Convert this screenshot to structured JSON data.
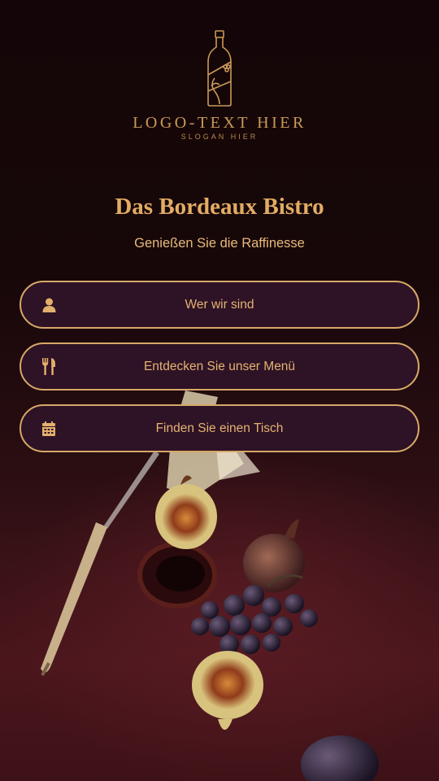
{
  "logo": {
    "text": "LOGO-TEXT HIER",
    "slogan": "SLOGAN HIER",
    "icon": "wine-bottle-icon"
  },
  "header": {
    "title": "Das Bordeaux Bistro",
    "subtitle": "Genießen Sie die Raffinesse"
  },
  "menu": {
    "items": [
      {
        "label": "Wer wir sind",
        "icon": "user-icon"
      },
      {
        "label": "Entdecken Sie unser Menü",
        "icon": "fork-knife-icon"
      },
      {
        "label": "Finden Sie einen Tisch",
        "icon": "calendar-icon"
      }
    ]
  },
  "colors": {
    "accent": "#d7a868",
    "button_bg": "#2e1225",
    "background": "#150709"
  }
}
